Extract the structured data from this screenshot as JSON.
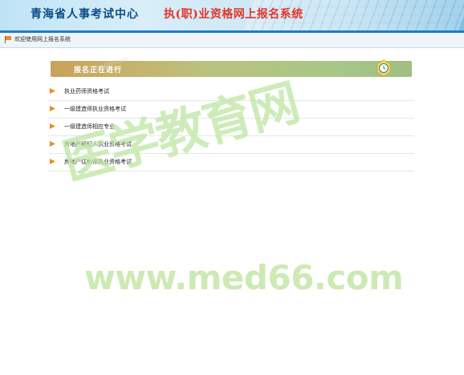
{
  "header": {
    "site_title": "青海省人事考试中心",
    "system_title": "执(职)业资格网上报名系统"
  },
  "welcome": {
    "text": "欢迎使用网上报名系统"
  },
  "banner": {
    "title": "报名正在进行"
  },
  "exams": [
    {
      "label": "执业药师资格考试"
    },
    {
      "label": "一级建造师执业资格考试"
    },
    {
      "label": "一级建造师相应专业"
    },
    {
      "label": "房地产经纪人执业资格考试"
    },
    {
      "label": "房地产估价师执业资格考试"
    }
  ],
  "watermark": {
    "cn": "医学教育网",
    "url": "www.med66.com"
  },
  "colors": {
    "header_blue": "#0a4c86",
    "system_title_red": "#e4342a",
    "accent_blue_line": "#1f7cc4",
    "bullet_orange": "#f08a24",
    "watermark_green": "#bde6a4"
  },
  "icons": [
    "flag-icon",
    "clock-icon",
    "bullet-icon"
  ]
}
